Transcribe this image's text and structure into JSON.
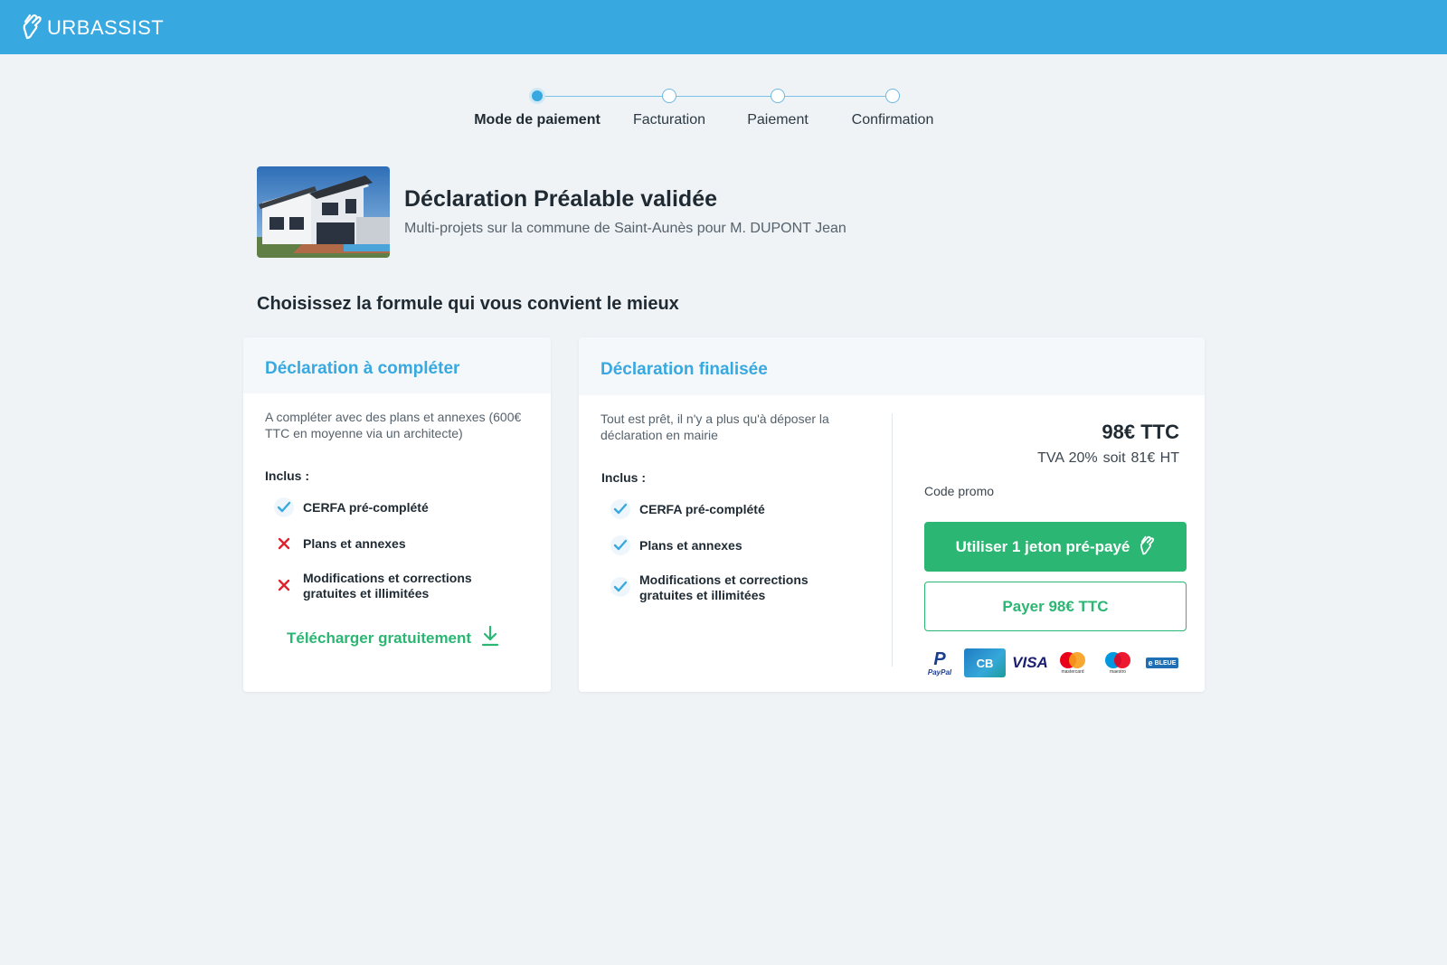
{
  "brand": {
    "name": "URBASSIST",
    "color": "#38a9e0",
    "accent_green": "#2bb673"
  },
  "stepper": {
    "steps": [
      {
        "label": "Mode de paiement",
        "active": true
      },
      {
        "label": "Facturation",
        "active": false
      },
      {
        "label": "Paiement",
        "active": false
      },
      {
        "label": "Confirmation",
        "active": false
      }
    ]
  },
  "project": {
    "title": "Déclaration Préalable validée",
    "subtitle": "Multi-projets sur la commune de Saint-Aunès pour M. DUPONT Jean"
  },
  "section_title": "Choisissez la formule qui vous convient le mieux",
  "offer_left": {
    "title": "Déclaration à compléter",
    "description": "A compléter avec des plans et annexes (600€ TTC en moyenne via un architecte)",
    "included_label": "Inclus :",
    "features": [
      {
        "label": "CERFA pré-complété",
        "included": true
      },
      {
        "label": "Plans et annexes",
        "included": false
      },
      {
        "label": "Modifications et corrections gratuites et illimitées",
        "included": false
      }
    ],
    "download_label": "Télécharger gratuitement"
  },
  "offer_right": {
    "title": "Déclaration finalisée",
    "description": "Tout est prêt, il n'y a plus qu'à déposer la déclaration en mairie",
    "included_label": "Inclus :",
    "features": [
      {
        "label": "CERFA pré-complété",
        "included": true
      },
      {
        "label": "Plans et annexes",
        "included": true
      },
      {
        "label": "Modifications et corrections gratuites et illimitées",
        "included": true
      }
    ],
    "price": "98€ TTC",
    "tva_label": "TVA 20%",
    "soit_label": "soit",
    "ht_price": "81€ HT",
    "promo_label": "Code promo",
    "token_button": "Utiliser 1 jeton pré-payé",
    "pay_button": "Payer 98€ TTC",
    "payment_methods": [
      {
        "name": "paypal-logo",
        "label_top": "P",
        "label_bottom": "PayPal"
      },
      {
        "name": "cb-logo",
        "label": "CB"
      },
      {
        "name": "visa-logo",
        "label": "VISA"
      },
      {
        "name": "mastercard-logo",
        "label": "mastercard"
      },
      {
        "name": "maestro-logo",
        "label": "maestro"
      },
      {
        "name": "e-carte-bleue-logo",
        "label_small": "e",
        "label": "BLEUE"
      }
    ]
  }
}
